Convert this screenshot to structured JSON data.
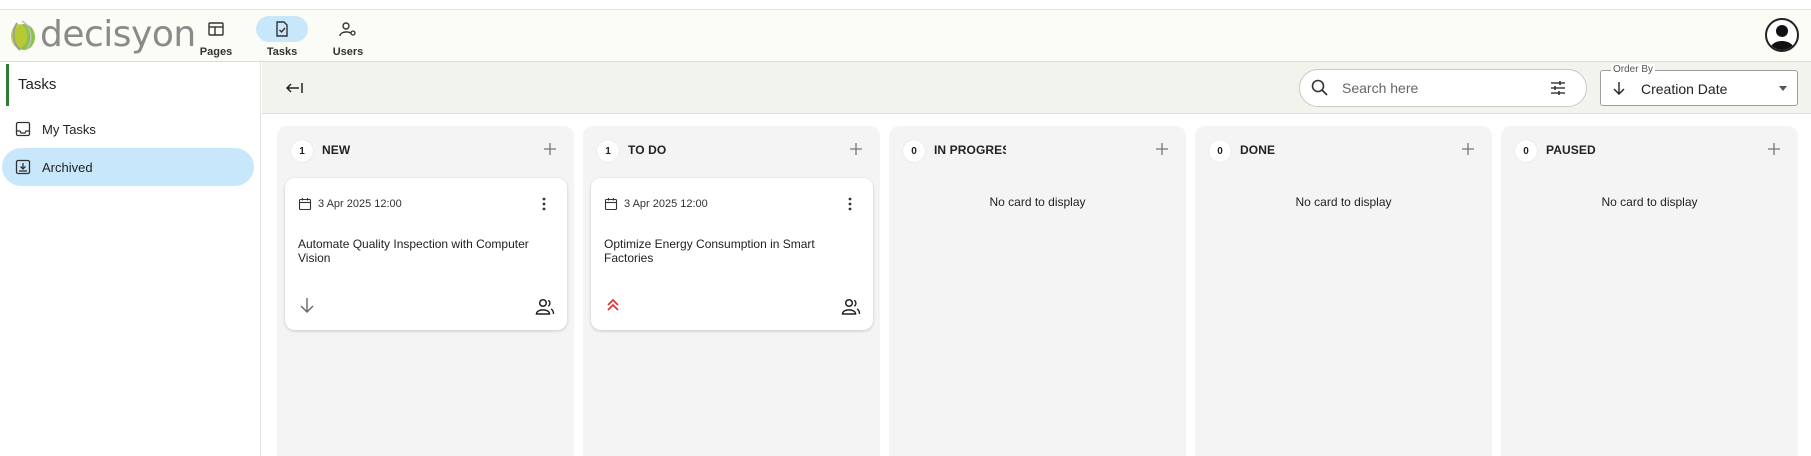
{
  "brand": {
    "logo_text": "decisyon",
    "accent": "#2e7d32",
    "nav_active": "#c8e7fa"
  },
  "nav": [
    {
      "label": "Pages",
      "icon": "dashboard-icon",
      "active": false
    },
    {
      "label": "Tasks",
      "icon": "task-check-icon",
      "active": true
    },
    {
      "label": "Users",
      "icon": "user-settings-icon",
      "active": false
    }
  ],
  "sidebar": {
    "title": "Tasks",
    "items": [
      {
        "label": "My Tasks",
        "icon": "inbox-icon",
        "active": false
      },
      {
        "label": "Archived",
        "icon": "archive-icon",
        "active": true
      }
    ]
  },
  "toolbar": {
    "search_placeholder": "Search here",
    "order_by_label": "Order By",
    "order_by_value": "Creation Date"
  },
  "columns": [
    {
      "title": "NEW",
      "count": "1",
      "cards": [
        {
          "date": "3 Apr 2025 12:00",
          "title": "Automate Quality Inspection with Computer Vision",
          "priority": "low"
        }
      ]
    },
    {
      "title": "TO DO",
      "count": "1",
      "cards": [
        {
          "date": "3 Apr 2025 12:00",
          "title": "Optimize Energy Consumption in Smart Factories",
          "priority": "high"
        }
      ]
    },
    {
      "title": "IN PROGRESS",
      "count": "0",
      "empty_text": "No card to display"
    },
    {
      "title": "DONE",
      "count": "0",
      "empty_text": "No card to display"
    },
    {
      "title": "PAUSED",
      "count": "0",
      "empty_text": "No card to display"
    }
  ],
  "colors": {
    "priority_high": "#e53935",
    "priority_low": "#666666"
  }
}
